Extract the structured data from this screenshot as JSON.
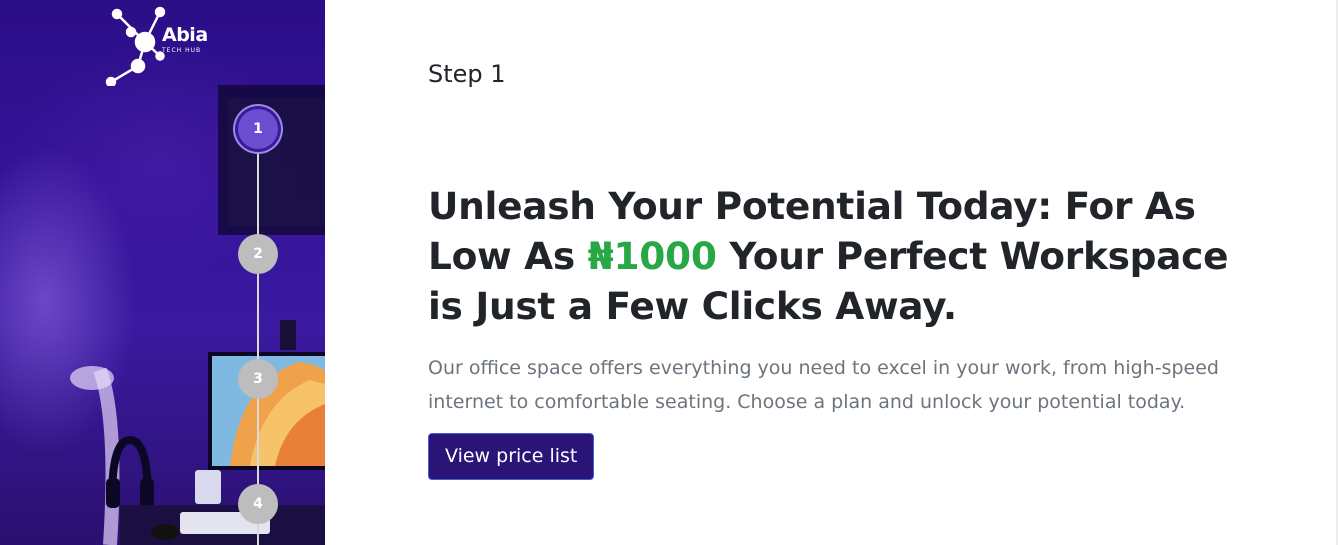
{
  "brand": {
    "name": "Abia",
    "tagline": "TECH HUB"
  },
  "stepper": {
    "active_step": 1,
    "steps": [
      "1",
      "2",
      "3",
      "4"
    ]
  },
  "main": {
    "step_label": "Step 1",
    "headline_part1": "Unleash Your Potential Today: For As Low As ",
    "headline_price": "₦1000",
    "headline_part2": " Your Perfect Workspace is Just a Few Clicks Away.",
    "description": "Our office space offers everything you need to excel in your work, from high-speed internet to comfortable seating. Choose a plan and unlock your potential today.",
    "cta_label": "View price list"
  },
  "colors": {
    "accent_green": "#28a745",
    "button_bg": "#2a1478",
    "step_active": "#6b4fd0",
    "step_inactive": "#bdbdbd",
    "sidebar_bg": "#35139a"
  }
}
